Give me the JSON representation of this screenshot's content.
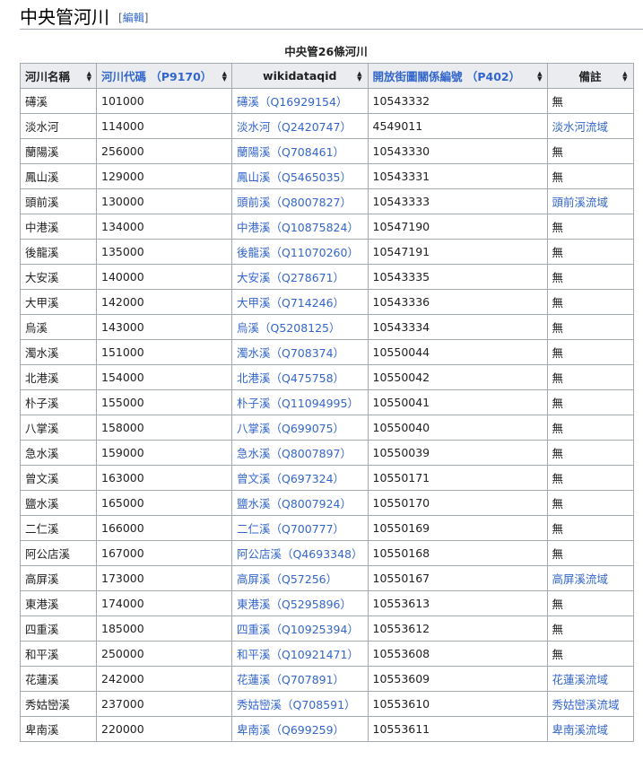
{
  "section": {
    "title": "中央管河川",
    "edit_open": "[",
    "edit_label": "編輯",
    "edit_close": "]"
  },
  "table": {
    "caption": "中央管26條河川",
    "headers": [
      {
        "label": "河川名稱",
        "link": false
      },
      {
        "label": "河川代碼 （P9170）",
        "link": true
      },
      {
        "label": "wikidataqid",
        "link": false
      },
      {
        "label": "開放街圖關係編號 （P402）",
        "link": true
      },
      {
        "label": "備註",
        "link": false
      }
    ],
    "rows": [
      {
        "name": "礡溪",
        "code": "101000",
        "qid": "礡溪（Q16929154）",
        "osm": "10543332",
        "note": "無",
        "note_link": false
      },
      {
        "name": "淡水河",
        "code": "114000",
        "qid": "淡水河（Q2420747）",
        "osm": "4549011",
        "note": "淡水河流域",
        "note_link": true
      },
      {
        "name": "蘭陽溪",
        "code": "256000",
        "qid": "蘭陽溪（Q708461）",
        "osm": "10543330",
        "note": "無",
        "note_link": false
      },
      {
        "name": "鳳山溪",
        "code": "129000",
        "qid": "鳳山溪（Q5465035）",
        "osm": "10543331",
        "note": "無",
        "note_link": false
      },
      {
        "name": "頭前溪",
        "code": "130000",
        "qid": "頭前溪（Q8007827）",
        "osm": "10543333",
        "note": "頭前溪流域",
        "note_link": true
      },
      {
        "name": "中港溪",
        "code": "134000",
        "qid": "中港溪（Q10875824）",
        "osm": "10547190",
        "note": "無",
        "note_link": false
      },
      {
        "name": "後龍溪",
        "code": "135000",
        "qid": "後龍溪（Q11070260）",
        "osm": "10547191",
        "note": "無",
        "note_link": false
      },
      {
        "name": "大安溪",
        "code": "140000",
        "qid": "大安溪（Q278671）",
        "osm": "10543335",
        "note": "無",
        "note_link": false
      },
      {
        "name": "大甲溪",
        "code": "142000",
        "qid": "大甲溪（Q714246）",
        "osm": "10543336",
        "note": "無",
        "note_link": false
      },
      {
        "name": "烏溪",
        "code": "143000",
        "qid": "烏溪（Q5208125）",
        "osm": "10543334",
        "note": "無",
        "note_link": false
      },
      {
        "name": "濁水溪",
        "code": "151000",
        "qid": "濁水溪（Q708374）",
        "osm": "10550044",
        "note": "無",
        "note_link": false
      },
      {
        "name": "北港溪",
        "code": "154000",
        "qid": "北港溪（Q475758）",
        "osm": "10550042",
        "note": "無",
        "note_link": false
      },
      {
        "name": "朴子溪",
        "code": "155000",
        "qid": "朴子溪（Q11094995）",
        "osm": "10550041",
        "note": "無",
        "note_link": false
      },
      {
        "name": "八掌溪",
        "code": "158000",
        "qid": "八掌溪（Q699075）",
        "osm": "10550040",
        "note": "無",
        "note_link": false
      },
      {
        "name": "急水溪",
        "code": "159000",
        "qid": "急水溪（Q8007897）",
        "osm": "10550039",
        "note": "無",
        "note_link": false
      },
      {
        "name": "曾文溪",
        "code": "163000",
        "qid": "曾文溪（Q697324）",
        "osm": "10550171",
        "note": "無",
        "note_link": false
      },
      {
        "name": "鹽水溪",
        "code": "165000",
        "qid": "鹽水溪（Q8007924）",
        "osm": "10550170",
        "note": "無",
        "note_link": false
      },
      {
        "name": "二仁溪",
        "code": "166000",
        "qid": "二仁溪（Q700777）",
        "osm": "10550169",
        "note": "無",
        "note_link": false
      },
      {
        "name": "阿公店溪",
        "code": "167000",
        "qid": "阿公店溪（Q4693348）",
        "osm": "10550168",
        "note": "無",
        "note_link": false
      },
      {
        "name": "高屏溪",
        "code": "173000",
        "qid": "高屏溪（Q57256）",
        "osm": "10550167",
        "note": "高屏溪流域",
        "note_link": true
      },
      {
        "name": "東港溪",
        "code": "174000",
        "qid": "東港溪（Q5295896）",
        "osm": "10553613",
        "note": "無",
        "note_link": false
      },
      {
        "name": "四重溪",
        "code": "185000",
        "qid": "四重溪（Q10925394）",
        "osm": "10553612",
        "note": "無",
        "note_link": false
      },
      {
        "name": "和平溪",
        "code": "250000",
        "qid": "和平溪（Q10921471）",
        "osm": "10553608",
        "note": "無",
        "note_link": false
      },
      {
        "name": "花蓮溪",
        "code": "242000",
        "qid": "花蓮溪（Q707891）",
        "osm": "10553609",
        "note": "花蓮溪流域",
        "note_link": true
      },
      {
        "name": "秀姑巒溪",
        "code": "237000",
        "qid": "秀姑巒溪（Q708591）",
        "osm": "10553610",
        "note": "秀姑巒溪流域",
        "note_link": true
      },
      {
        "name": "卑南溪",
        "code": "220000",
        "qid": "卑南溪（Q699259）",
        "osm": "10553611",
        "note": "卑南溪流域",
        "note_link": true
      }
    ]
  },
  "colors": {
    "link": "#3366cc",
    "header_bg": "#eaecf0",
    "border": "#a2a9b1",
    "text": "#202122"
  },
  "icons": {
    "sort": "sort-arrows-icon"
  }
}
